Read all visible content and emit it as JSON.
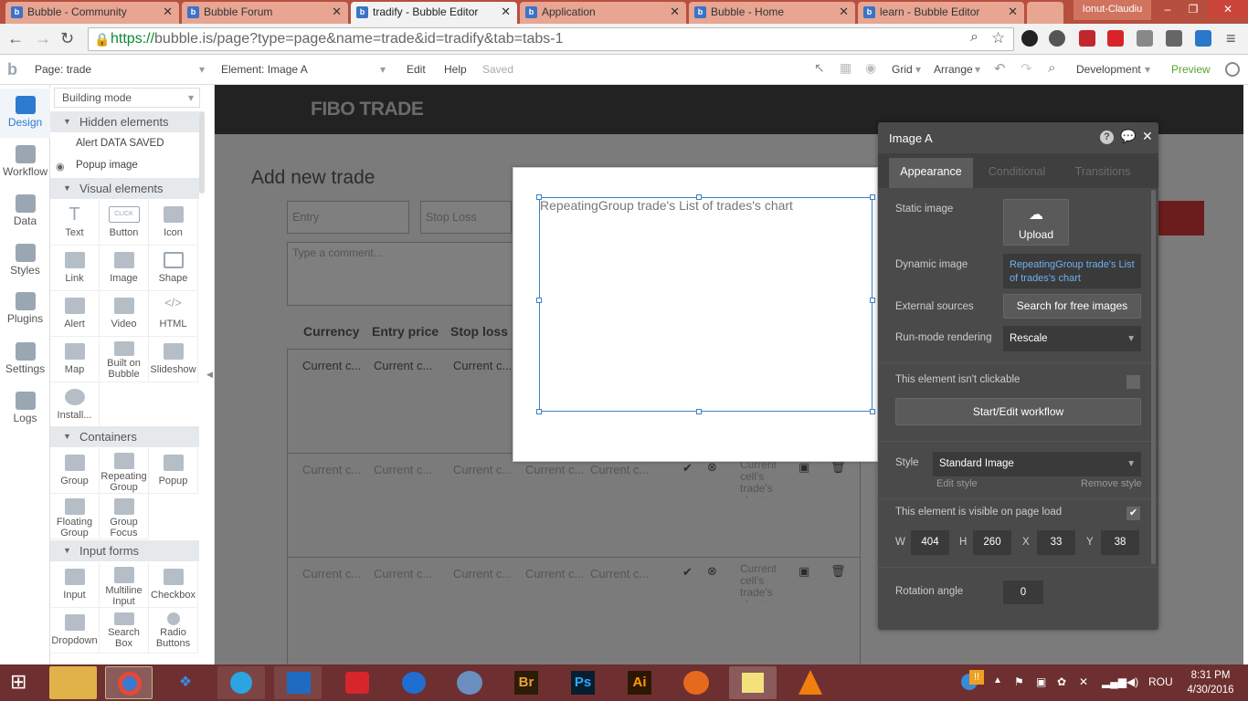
{
  "browser": {
    "tabs": [
      {
        "label": "Bubble - Community",
        "active": false
      },
      {
        "label": "Bubble Forum",
        "active": false
      },
      {
        "label": "tradify - Bubble Editor",
        "active": true
      },
      {
        "label": "Application",
        "active": false
      },
      {
        "label": "Bubble - Home",
        "active": false
      },
      {
        "label": "learn - Bubble Editor",
        "active": false
      }
    ],
    "user": "Ionut-Claudiu",
    "url_scheme": "https://",
    "url_rest": "bubble.is/page?type=page&name=trade&id=tradify&tab=tabs-1"
  },
  "toolbar": {
    "page_label": "Page: trade",
    "element_label": "Element: Image A",
    "edit": "Edit",
    "help": "Help",
    "saved": "Saved",
    "grid": "Grid",
    "arrange": "Arrange",
    "environment": "Development",
    "preview": "Preview"
  },
  "rail": [
    {
      "label": "Design",
      "active": true
    },
    {
      "label": "Workflow",
      "active": false
    },
    {
      "label": "Data",
      "active": false
    },
    {
      "label": "Styles",
      "active": false
    },
    {
      "label": "Plugins",
      "active": false
    },
    {
      "label": "Settings",
      "active": false
    },
    {
      "label": "Logs",
      "active": false
    }
  ],
  "palette": {
    "mode": "Building mode",
    "hidden_header": "Hidden elements",
    "hidden_items": [
      "Alert DATA SAVED",
      "Popup image"
    ],
    "visual_header": "Visual elements",
    "visual_items": [
      "Text",
      "Button",
      "Icon",
      "Link",
      "Image",
      "Shape",
      "Alert",
      "Video",
      "HTML",
      "Map",
      "Built on Bubble",
      "Slideshow",
      "Install..."
    ],
    "containers_header": "Containers",
    "container_items": [
      "Group",
      "Repeating Group",
      "Popup",
      "Floating Group",
      "Group Focus"
    ],
    "input_header": "Input forms",
    "input_items": [
      "Input",
      "Multiline Input",
      "Checkbox",
      "Dropdown",
      "Search Box",
      "Radio Buttons"
    ],
    "button_icon_text": "CLICK"
  },
  "canvas": {
    "brand": "FIBO TRADE",
    "heading": "Add new trade",
    "entry_placeholder": "Entry",
    "stoploss_placeholder": "Stop Loss",
    "comment_placeholder": "Type a comment...",
    "columns": [
      "Currency",
      "Entry price",
      "Stop loss"
    ],
    "cell": "Current c...",
    "chart_cell": "Current cell's trade's chart",
    "image_text": "RepeatingGroup trade's List of trades's chart"
  },
  "panel": {
    "title": "Image A",
    "tabs": [
      "Appearance",
      "Conditional",
      "Transitions"
    ],
    "static_image_label": "Static image",
    "upload": "Upload",
    "dynamic_image_label": "Dynamic image",
    "dynamic_image_value": "RepeatingGroup trade's List of trades's chart",
    "external_label": "External sources",
    "external_button": "Search for free images",
    "runmode_label": "Run-mode rendering",
    "runmode_value": "Rescale",
    "clickable_label": "This element isn't clickable",
    "workflow_button": "Start/Edit workflow",
    "style_label": "Style",
    "style_value": "Standard Image",
    "edit_style": "Edit style",
    "remove_style": "Remove style",
    "visible_label": "This element is visible on page load",
    "w_label": "W",
    "w": "404",
    "h_label": "H",
    "h": "260",
    "x_label": "X",
    "x": "33",
    "y_label": "Y",
    "y": "38",
    "rotation_label": "Rotation angle",
    "rotation": "0"
  },
  "taskbar": {
    "lang": "ROU",
    "time": "8:31 PM",
    "date": "4/30/2016",
    "apps": [
      "Br",
      "Ps",
      "Ai"
    ]
  }
}
